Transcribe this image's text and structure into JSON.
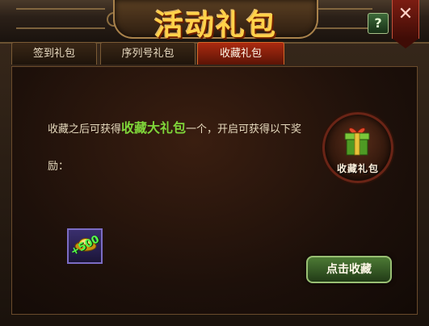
{
  "window": {
    "title": "活动礼包",
    "help_label": "?",
    "close_label": "✕"
  },
  "tabs": [
    {
      "label": "签到礼包",
      "active": false
    },
    {
      "label": "序列号礼包",
      "active": false
    },
    {
      "label": "收藏礼包",
      "active": true
    }
  ],
  "content": {
    "desc_before": "收藏之后可获得",
    "desc_highlight": "收藏大礼包",
    "desc_after": "一个，开启可获得以下奖",
    "desc_line2": "励：",
    "gift_label": "收藏礼包",
    "reward": {
      "icon": "gold-ingot-icon",
      "count": "+500"
    },
    "collect_button_label": "点击收藏"
  },
  "colors": {
    "highlight": "#7fd63a",
    "active_tab": "#ab2a10",
    "button": "#4c7a34"
  }
}
